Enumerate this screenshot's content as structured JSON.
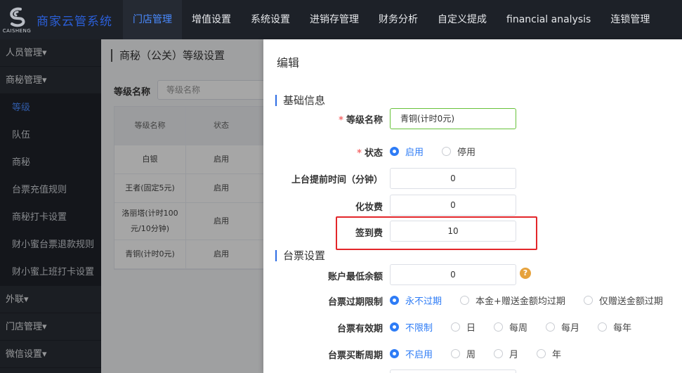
{
  "brand": {
    "logo_sub": "CAISHENG",
    "title": "商家云管系统"
  },
  "topnav": [
    "门店管理",
    "增值设置",
    "系统设置",
    "进销存管理",
    "财务分析",
    "自定义提成",
    "financial analysis",
    "连锁管理"
  ],
  "sidebar": {
    "groups": {
      "g1": "人员管理",
      "g2": "商秘管理",
      "g3": "外联",
      "g4": "门店管理",
      "g5": "微信设置"
    },
    "subs": [
      "等级",
      "队伍",
      "商秘",
      "台票充值规则",
      "商秘打卡设置",
      "财小蜜台票退款规则",
      "财小蜜上班打卡设置"
    ],
    "caret": "▾"
  },
  "page": {
    "title": "商秘（公关）等级设置",
    "filter_label": "等级名称",
    "filter_placeholder": "等级名称",
    "table": {
      "headers": [
        "等级名称",
        "状态"
      ],
      "rows": [
        [
          "白银",
          "启用"
        ],
        [
          "王者(固定5元)",
          "启用"
        ],
        [
          "洛丽塔(计时100元/10分钟)",
          "启用"
        ],
        [
          "青铜(计时0元)",
          "启用"
        ]
      ]
    }
  },
  "drawer": {
    "title": "编辑",
    "section1": "基础信息",
    "section2": "台票设置",
    "fields": {
      "level_name": {
        "label": "等级名称",
        "value": "青铜(计时0元)"
      },
      "status": {
        "label": "状态",
        "options": [
          "启用",
          "停用"
        ],
        "selected": "启用"
      },
      "advance_time": {
        "label": "上台提前时间（分钟）",
        "value": "0"
      },
      "makeup_fee": {
        "label": "化妆费",
        "value": "0"
      },
      "signin_fee": {
        "label": "签到费",
        "value": "10"
      },
      "min_balance": {
        "label": "账户最低余额",
        "value": "0",
        "help": "?"
      },
      "expire_limit": {
        "label": "台票过期限制",
        "options": [
          "永不过期",
          "本金+赠送金额均过期",
          "仅赠送金额过期"
        ],
        "selected": "永不过期"
      },
      "validity": {
        "label": "台票有效期",
        "options": [
          "不限制",
          "日",
          "每周",
          "每月",
          "每年"
        ],
        "selected": "不限制"
      },
      "buyout_cycle": {
        "label": "台票买断周期",
        "options": [
          "不启用",
          "周",
          "月",
          "年"
        ],
        "selected": "不启用"
      }
    }
  },
  "colors": {
    "accent": "#2e7cf6",
    "highlight": "#e3262a",
    "nav_bg": "#1d2128"
  }
}
